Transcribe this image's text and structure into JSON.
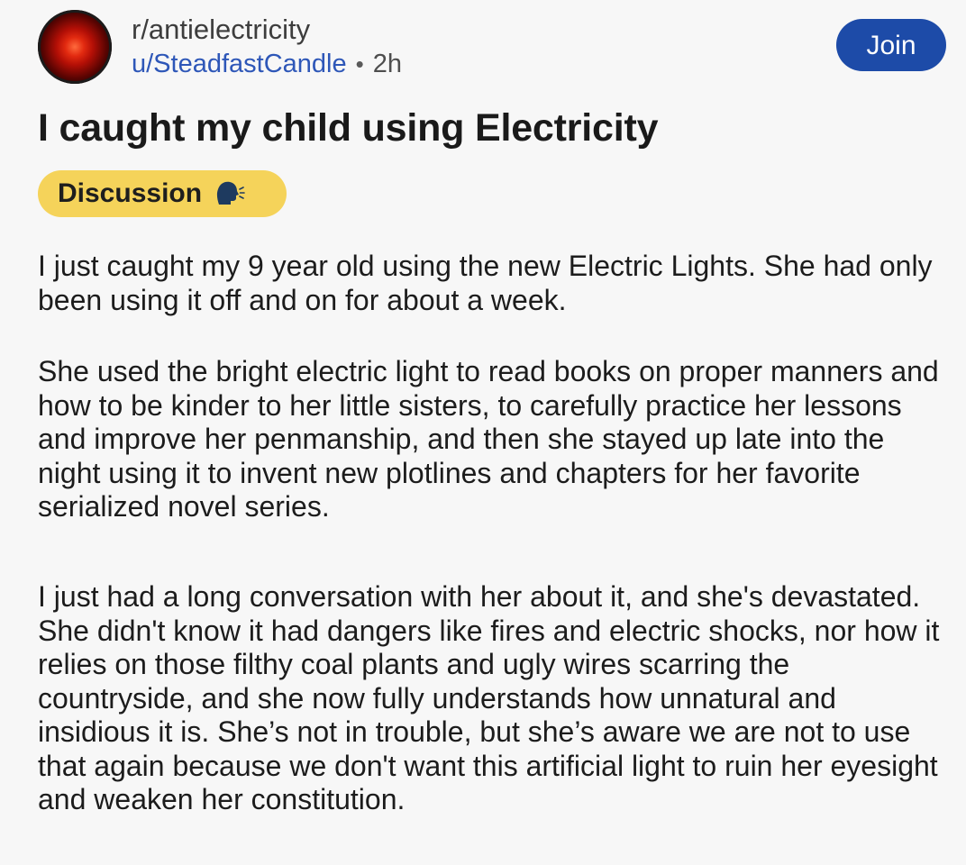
{
  "post": {
    "subreddit": "r/antielectricity",
    "username": "u/SteadfastCandle",
    "separator": "•",
    "time_ago": "2h",
    "join_label": "Join",
    "title": "I caught my child using Electricity",
    "flair": {
      "label": "Discussion",
      "icon": "speaking-head-icon",
      "color": "#f5d35a"
    },
    "paragraphs": [
      "I just caught my 9 year old using the new Electric Lights. She had only been using it off and on for about a week.",
      "She used the bright electric light to read books on proper manners and how to be kinder to her little sisters, to carefully practice her lessons and improve her penmanship, and then she stayed up late into the night using it to invent new plotlines and chapters for her favorite serialized novel series.",
      "I just had a long conversation with her about it, and she's devastated. She didn't know it had dangers like fires and electric shocks, nor how it relies on those filthy coal plants and ugly wires scarring the countryside, and she now fully understands how unnatural and insidious it is. She’s not in trouble, but she’s aware we are not to use that again because we don't want this artificial light to ruin her eyesight and weaken her constitution."
    ]
  },
  "colors": {
    "background": "#f7f7f7",
    "join_button": "#1d4ba8",
    "username": "#2e57b8"
  }
}
